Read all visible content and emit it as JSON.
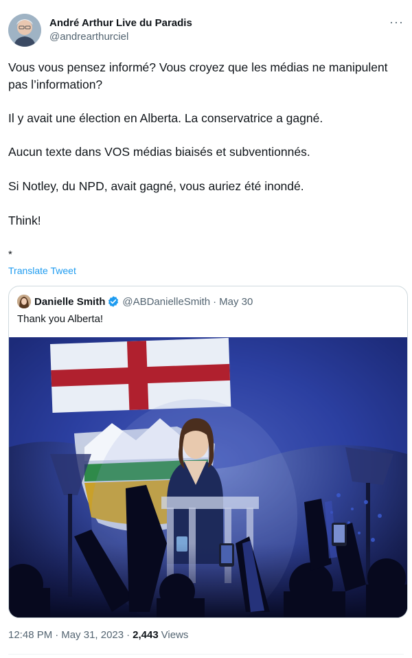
{
  "author": {
    "name": "André Arthur Live du Paradis",
    "handle": "@andrearthurciel"
  },
  "more_icon": "more-horizontal-icon",
  "tweet": {
    "paragraphs": [
      "Vous vous pensez informé? Vous croyez que les médias ne manipulent pas l’information?",
      "Il y avait une élection en Alberta. La conservatrice a gagné.",
      "Aucun texte dans VOS médias biaisés et subventionnés.",
      "Si Notley, du NPD, avait gagné, vous auriez été inondé.",
      "Think!",
      "*"
    ],
    "translate_label": "Translate Tweet"
  },
  "quoted": {
    "name": "Danielle Smith",
    "verified_icon": "verified-badge-icon",
    "handle": "@ABDanielleSmith",
    "dot": "·",
    "date": "May 30",
    "text": "Thank you Alberta!"
  },
  "footer": {
    "time": "12:48 PM",
    "dot1": "·",
    "date": "May 31, 2023",
    "dot2": "·",
    "views_count": "2,443",
    "views_label": "Views"
  },
  "colors": {
    "link": "#1d9bf0",
    "secondary_text": "#536471",
    "border": "#cfd9de"
  }
}
